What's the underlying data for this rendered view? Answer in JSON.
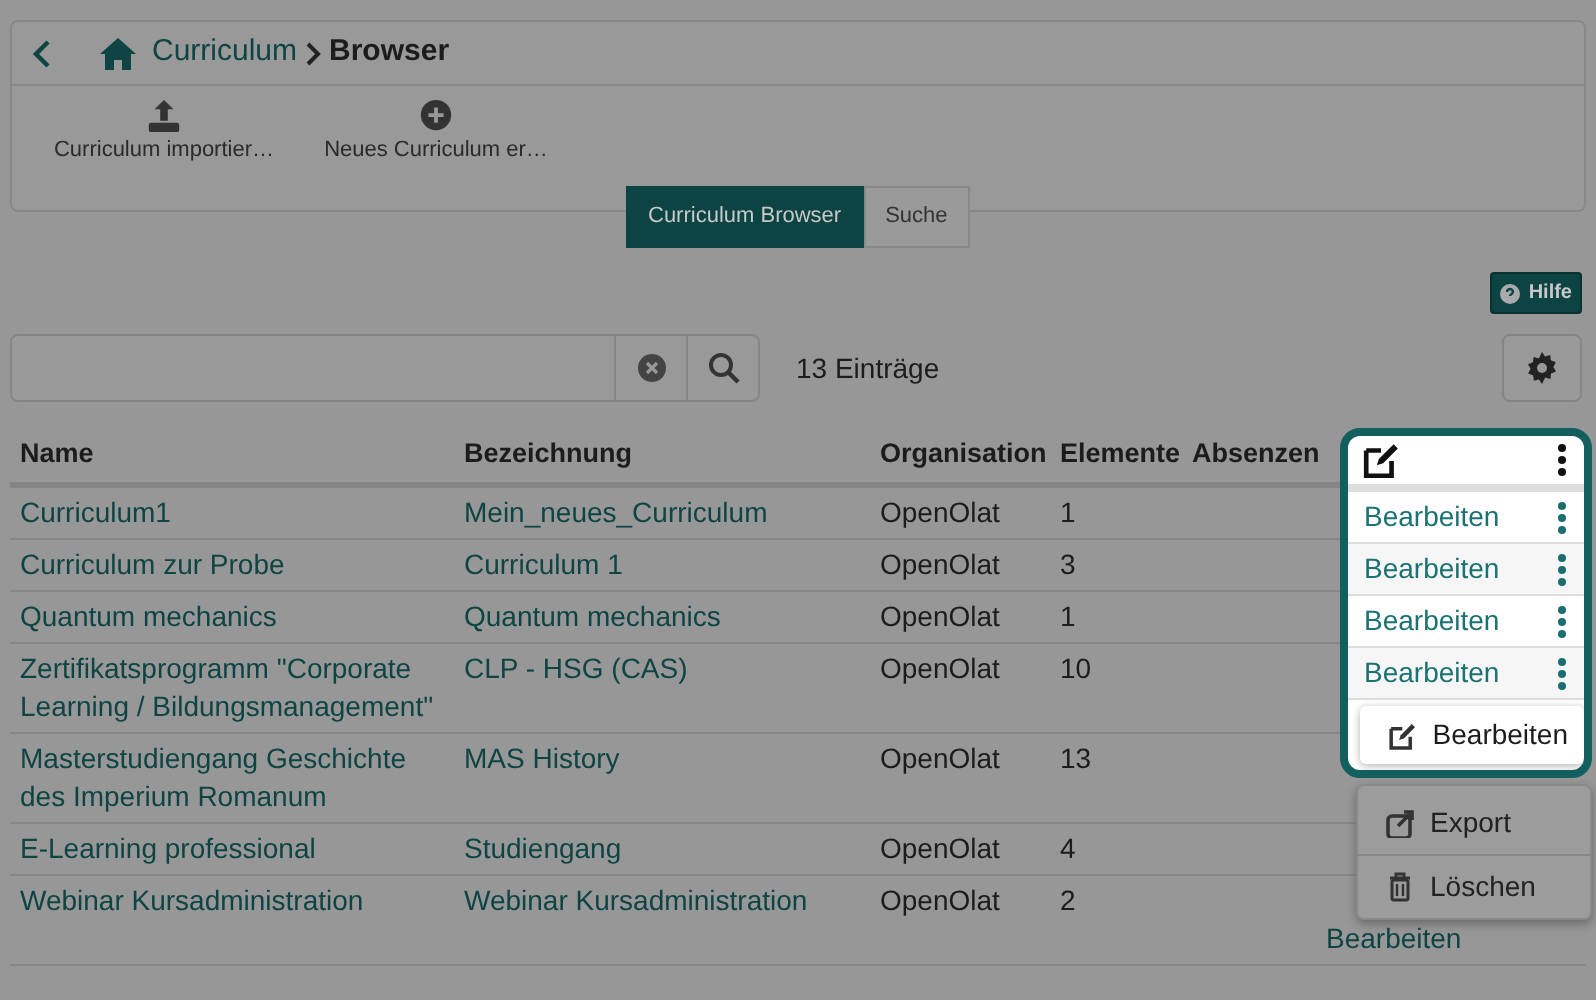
{
  "breadcrumb": [
    {
      "label": "Curriculum",
      "kind": "link"
    },
    {
      "label": "Browser",
      "kind": "current"
    }
  ],
  "toolbar": [
    {
      "label": "Curriculum importier…",
      "kind": "import"
    },
    {
      "label": "Neues Curriculum er…",
      "kind": "create"
    }
  ],
  "segments": [
    {
      "label": "Curriculum Browser",
      "selected": true
    },
    {
      "label": "Suche",
      "selected": false
    }
  ],
  "help": "Hilfe",
  "search": {
    "count": "13 Einträge"
  },
  "table": {
    "columns": [
      "Name",
      "Bezeichnung",
      "Organisation",
      "Elemente",
      "Absenzen"
    ],
    "rows": [
      {
        "cells": [
          "Curriculum1",
          "Mein_neues_Curriculum",
          "OpenOlat",
          "1"
        ]
      },
      {
        "cells": [
          "Curriculum zur Probe",
          "Curriculum 1",
          "OpenOlat",
          "3"
        ]
      },
      {
        "cells": [
          "Quantum mechanics",
          "Quantum mechanics",
          "OpenOlat",
          "1"
        ]
      },
      {
        "cells": [
          "Zertifikatsprogramm \"Corporate Learning / Bildungsmanagement\"",
          "CLP - HSG (CAS)",
          "OpenOlat",
          "10"
        ]
      },
      {
        "cells": [
          "Masterstudiengang Geschichte des Imperium Romanum",
          "MAS History",
          "OpenOlat",
          "13"
        ]
      },
      {
        "cells": [
          "E-Learning professional",
          "Studiengang",
          "OpenOlat",
          "4"
        ]
      },
      {
        "cells": [
          "Webinar Kursadministration",
          "Webinar Kursadministration",
          "OpenOlat",
          "2"
        ],
        "action": "Bearbeiten"
      }
    ]
  },
  "spotlight": {
    "rows": [
      "Bearbeiten",
      "Bearbeiten",
      "Bearbeiten",
      "Bearbeiten"
    ],
    "popup_item": "Bearbeiten"
  },
  "menu": [
    {
      "label": "Export",
      "kind": "export"
    },
    {
      "label": "Löschen",
      "kind": "delete"
    }
  ]
}
